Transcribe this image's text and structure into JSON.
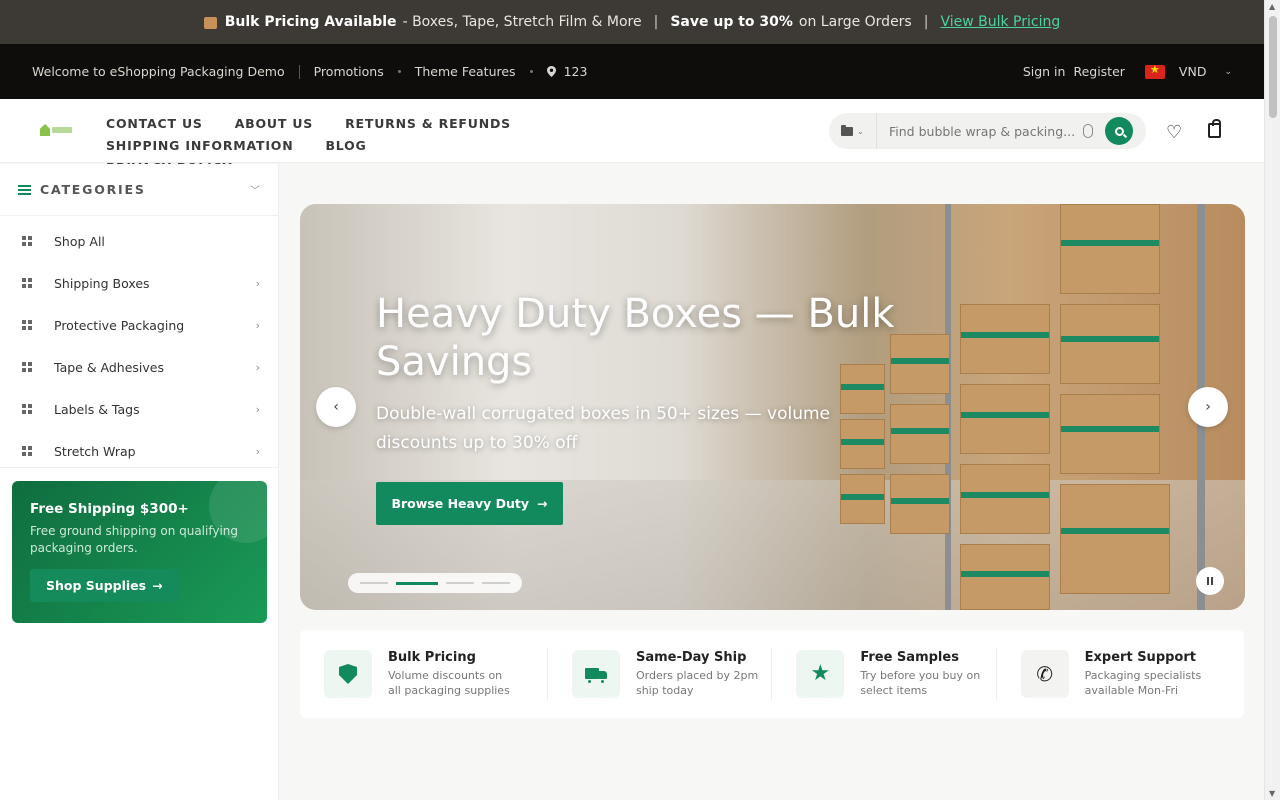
{
  "announcement": {
    "lead": "Bulk Pricing Available",
    "detail": "- Boxes, Tape, Stretch Film & More",
    "save": "Save up to 30%",
    "save_rest": "on Large Orders",
    "link": "View Bulk Pricing",
    "sep": "|"
  },
  "topbar": {
    "welcome": "Welcome to eShopping Packaging Demo",
    "promotions": "Promotions",
    "features": "Theme Features",
    "location": "123",
    "signin": "Sign in",
    "register": "Register",
    "currency": "VND"
  },
  "nav": {
    "items": [
      "CONTACT US",
      "ABOUT US",
      "RETURNS & REFUNDS",
      "SHIPPING INFORMATION",
      "BLOG",
      "PRIVACY POLICY"
    ]
  },
  "search": {
    "placeholder": "Find bubble wrap & packing...",
    "value": "Find bubble wrap & packing.|"
  },
  "sidebar": {
    "title": "CATEGORIES",
    "items": [
      "Shop All",
      "Shipping Boxes",
      "Protective Packaging",
      "Tape & Adhesives",
      "Labels & Tags",
      "Stretch Wrap"
    ],
    "promo": {
      "title": "Free Shipping $300+",
      "text": "Free ground shipping on qualifying packaging orders.",
      "button": "Shop Supplies"
    }
  },
  "hero": {
    "title": "Heavy Duty Boxes — Bulk Savings",
    "subtitle": "Double-wall corrugated boxes in 50+ sizes — volume discounts up to 30% off",
    "cta": "Browse Heavy Duty",
    "slides": 4,
    "active_slide": 2
  },
  "features": [
    {
      "title": "Bulk Pricing",
      "text": "Volume discounts on all packaging supplies",
      "icon": "shield-check-icon"
    },
    {
      "title": "Same-Day Ship",
      "text": "Orders placed by 2pm ship today",
      "icon": "truck-icon"
    },
    {
      "title": "Free Samples",
      "text": "Try before you buy on select items",
      "icon": "star-icon"
    },
    {
      "title": "Expert Support",
      "text": "Packaging specialists available Mon-Fri",
      "icon": "phone-icon"
    }
  ],
  "colors": {
    "accent": "#138a5e",
    "link": "#4cd3a0",
    "topbar": "#0f0d0b",
    "announce": "#3d3935"
  }
}
